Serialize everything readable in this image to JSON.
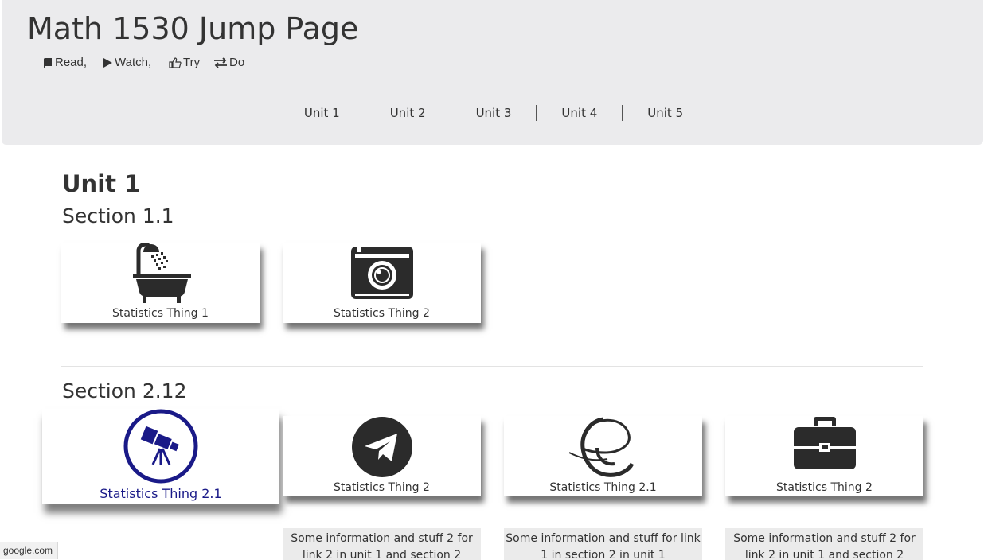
{
  "header": {
    "title": "Math 1530 Jump Page",
    "legend": [
      {
        "icon": "book-icon",
        "label": "Read,"
      },
      {
        "icon": "play-icon",
        "label": "Watch,"
      },
      {
        "icon": "thumbs-up-icon",
        "label": "Try"
      },
      {
        "icon": "exchange-icon",
        "label": "Do"
      }
    ],
    "units": [
      "Unit 1",
      "Unit 2",
      "Unit 3",
      "Unit 4",
      "Unit 5"
    ]
  },
  "main": {
    "unit_heading": "Unit 1",
    "sections": [
      {
        "heading": "Section 1.1",
        "cards": [
          {
            "icon": "bathtub-icon",
            "label": "Statistics Thing 1"
          },
          {
            "icon": "camera-icon",
            "label": "Statistics Thing 2"
          }
        ]
      },
      {
        "heading": "Section 2.12",
        "cards": [
          {
            "icon": "telescope-icon",
            "label": "Statistics Thing 2.1",
            "active": true
          },
          {
            "icon": "telegram-icon",
            "label": "Statistics Thing 2"
          },
          {
            "icon": "edge-icon",
            "label": "Statistics Thing 2.1"
          },
          {
            "icon": "briefcase-icon",
            "label": "Statistics Thing 2"
          }
        ],
        "info": [
          "",
          "Some information and stuff 2 for link 2 in unit 1 and section 2",
          "Some information and stuff for link 1 in section 2 in unit 1",
          "Some information and stuff 2 for link 2 in unit 1 and section 2"
        ]
      }
    ]
  },
  "colors": {
    "accent": "#1a1a88",
    "header_bg": "#ebebed"
  },
  "status_bar": "google.com"
}
